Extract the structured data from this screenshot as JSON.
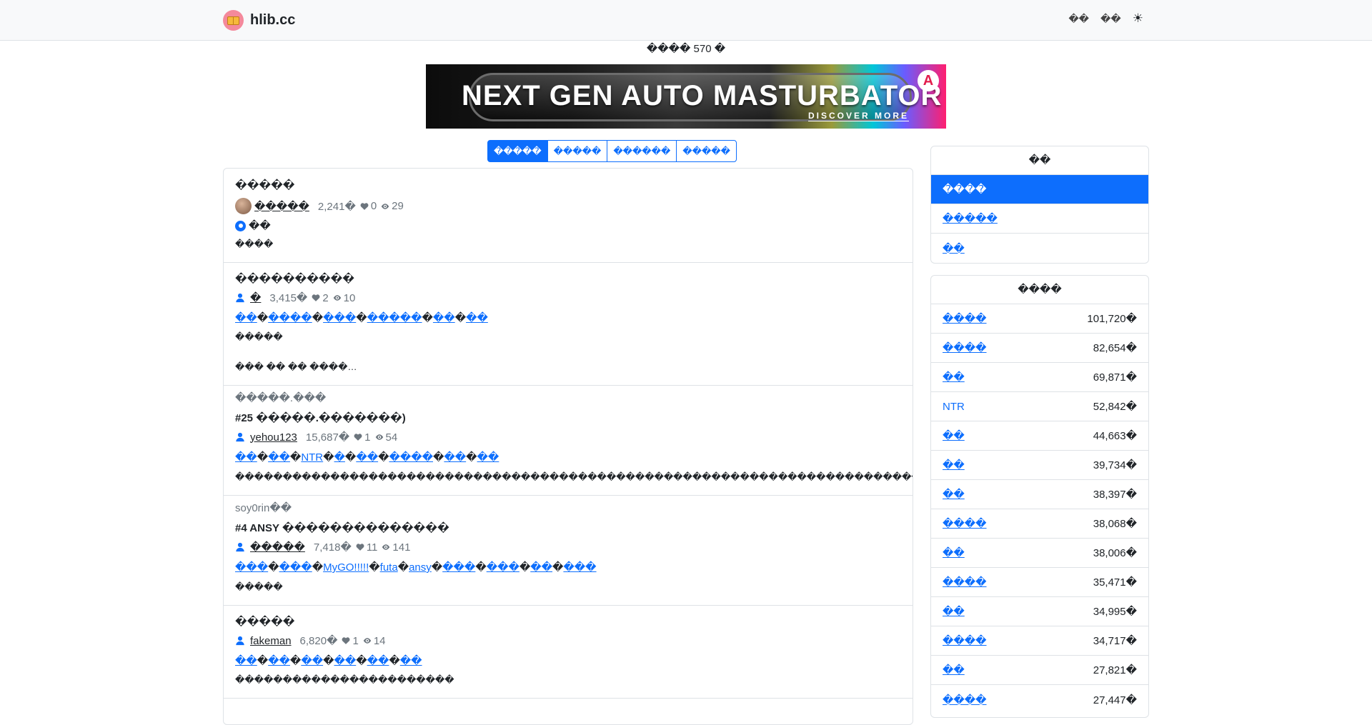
{
  "brand": {
    "name": "hlib.cc"
  },
  "nav": {
    "link1": "��",
    "link2": "��"
  },
  "online": {
    "text": "���� 570 �"
  },
  "ad": {
    "title": "NEXT GEN AUTO MASTURBATOR",
    "subtitle": "DISCOVER MORE",
    "logo": "A"
  },
  "sort_tabs": [
    "�����",
    "�����",
    "������",
    "�����"
  ],
  "posts": [
    {
      "series": "",
      "title": "�����",
      "author": "�����",
      "words": "2,241�",
      "likes": "0",
      "views": "29",
      "badge": "��",
      "tags": [],
      "snippet": "����",
      "snippet2": ""
    },
    {
      "series": "",
      "title": "����������",
      "author": "�",
      "words": "3,415�",
      "likes": "2",
      "views": "10",
      "badge": "",
      "tags": [
        "��",
        "����",
        "���",
        "�����",
        "��",
        "��"
      ],
      "snippet": "�����",
      "snippet2": "��� �� �� ����…"
    },
    {
      "series": "�����.���",
      "title": "#25 �����.�������)",
      "author": "yehou123",
      "words": "15,687�",
      "likes": "1",
      "views": "54",
      "badge": "",
      "tags": [
        "��",
        "��",
        "NTR",
        "�",
        "��",
        "����",
        "��",
        "��"
      ],
      "snippet": "�������������������������������������������������������������������������������������…",
      "snippet2": ""
    },
    {
      "series": "soy0rin��",
      "title": "#4 ANSY ��������������",
      "author": "�����",
      "words": "7,418�",
      "likes": "11",
      "views": "141",
      "badge": "",
      "tags": [
        "���",
        "���",
        "MyGO!!!!!",
        "futa",
        "ansy",
        "���",
        "���",
        "��",
        "���"
      ],
      "snippet": "�����",
      "snippet2": ""
    },
    {
      "series": "",
      "title": "�����",
      "author": "fakeman",
      "words": "6,820�",
      "likes": "1",
      "views": "14",
      "badge": "",
      "tags": [
        "��",
        "��",
        "��",
        "��",
        "��",
        "��"
      ],
      "snippet": "�����������������������",
      "snippet2": ""
    }
  ],
  "sidebar_nav": {
    "header": "��",
    "items": [
      "����",
      "�����",
      "��"
    ]
  },
  "sidebar_tags": {
    "header": "����",
    "items": [
      {
        "name": "����",
        "count": "101,720�"
      },
      {
        "name": "����",
        "count": "82,654�"
      },
      {
        "name": "��",
        "count": "69,871�"
      },
      {
        "name": "NTR",
        "count": "52,842�"
      },
      {
        "name": "��",
        "count": "44,663�"
      },
      {
        "name": "��",
        "count": "39,734�"
      },
      {
        "name": "��",
        "count": "38,397�"
      },
      {
        "name": "����",
        "count": "38,068�"
      },
      {
        "name": "��",
        "count": "38,006�"
      },
      {
        "name": "����",
        "count": "35,471�"
      },
      {
        "name": "��",
        "count": "34,995�"
      },
      {
        "name": "����",
        "count": "34,717�"
      },
      {
        "name": "��",
        "count": "27,821�"
      },
      {
        "name": "����",
        "count": "27,447�"
      }
    ]
  },
  "colors": {
    "primary": "#0d6efd",
    "muted": "#6c757d",
    "border": "#dee2e6"
  }
}
